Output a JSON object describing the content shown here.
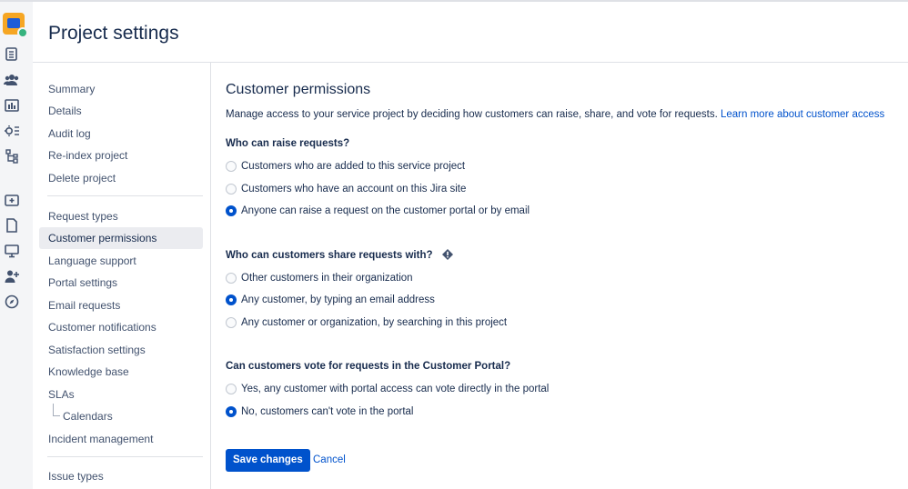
{
  "header": {
    "title": "Project settings"
  },
  "nav": {
    "group1": [
      "Summary",
      "Details",
      "Audit log",
      "Re-index project",
      "Delete project"
    ],
    "group2": [
      "Request types",
      "Customer permissions",
      "Language support",
      "Portal settings",
      "Email requests",
      "Customer notifications",
      "Satisfaction settings",
      "Knowledge base",
      "SLAs",
      "Calendars",
      "Incident management"
    ],
    "group3": [
      "Issue types"
    ],
    "active": "Customer permissions"
  },
  "main": {
    "title": "Customer permissions",
    "description": "Manage access to your service project by deciding how customers can raise, share, and vote for requests.",
    "learn_more": "Learn more about customer access",
    "raise": {
      "question": "Who can raise requests?",
      "options": [
        "Customers who are added to this service project",
        "Customers who have an account on this Jira site",
        "Anyone can raise a request on the customer portal or by email"
      ],
      "selected": 2
    },
    "share": {
      "question": "Who can customers share requests with?",
      "options": [
        "Other customers in their organization",
        "Any customer, by typing an email address",
        "Any customer or organization, by searching in this project"
      ],
      "selected": 1
    },
    "vote": {
      "question": "Can customers vote for requests in the Customer Portal?",
      "options": [
        "Yes, any customer with portal access can vote directly in the portal",
        "No, customers can't vote in the portal"
      ],
      "selected": 1
    },
    "save_label": "Save changes",
    "cancel_label": "Cancel"
  },
  "icons": {
    "rail": [
      "jsm-app-icon",
      "queues-icon",
      "customers-icon",
      "reports-icon",
      "settings-icon",
      "workflow-icon",
      "add-item-icon",
      "page-icon",
      "monitor-icon",
      "add-person-icon",
      "compass-icon"
    ],
    "help": "help-icon"
  },
  "colors": {
    "accent": "#0052cc",
    "text": "#172b4d",
    "nav_text": "#42526e",
    "active_bg": "#ebecf0"
  }
}
